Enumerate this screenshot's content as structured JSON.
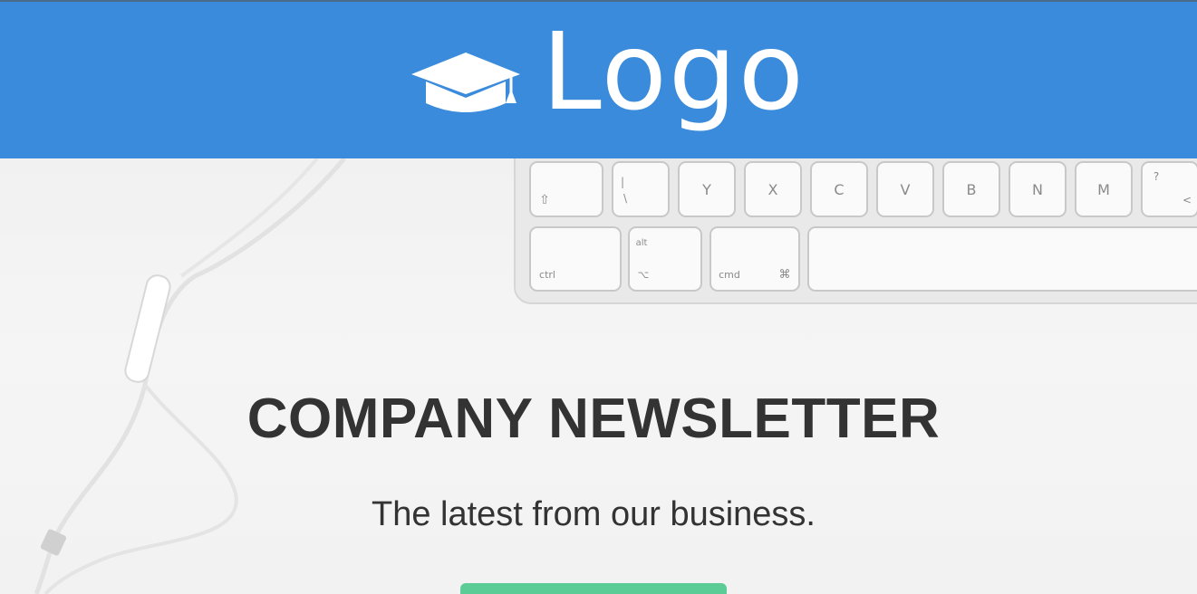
{
  "header": {
    "logo_text": "Logo",
    "logo_icon": "graduation-cap-icon",
    "background_color": "#3a8bdb"
  },
  "hero": {
    "title": "COMPANY NEWSLETTER",
    "subtitle": "The latest from our business.",
    "keyboard_keys_row1": [
      "",
      "|\\",
      "Y",
      "X",
      "C",
      "V",
      "B",
      "N",
      "M",
      "?"
    ],
    "keyboard_keys_row2": [
      "ctrl",
      "alt",
      "cmd",
      ""
    ]
  },
  "cta": {
    "color": "#5ccc96"
  },
  "colors": {
    "text": "#333333"
  }
}
